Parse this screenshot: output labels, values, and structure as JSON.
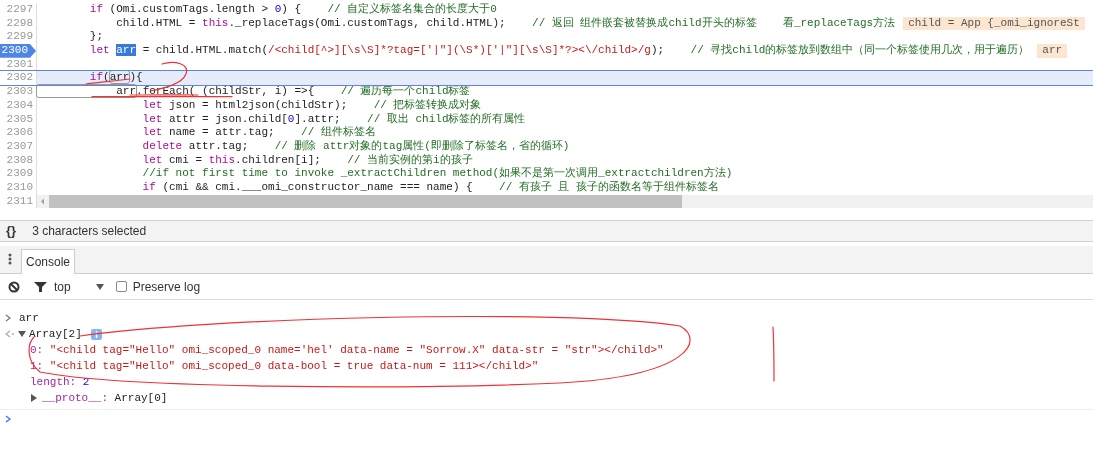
{
  "code_lines": [
    {
      "number": "2297",
      "breakpoint": false,
      "current": false,
      "tokens": [
        {
          "text": "        if",
          "kind": "keyword"
        },
        {
          "text": " (Omi.customTags.length > ",
          "kind": "plain"
        },
        {
          "text": "0",
          "kind": "number"
        },
        {
          "text": ") {    ",
          "kind": "plain"
        },
        {
          "text": "// 自定义标签名集合的长度大于0",
          "kind": "comment"
        }
      ]
    },
    {
      "number": "2298",
      "breakpoint": false,
      "current": false,
      "tokens": [
        {
          "text": "            child.HTML = ",
          "kind": "plain"
        },
        {
          "text": "this",
          "kind": "keyword"
        },
        {
          "text": "._replaceTags(Omi.customTags, child.HTML);    ",
          "kind": "plain"
        },
        {
          "text": "// 返回 组件嵌套被替换成child开头的标签    看_replaceTags方法",
          "kind": "comment"
        }
      ],
      "inline_value": "child = App {_omi_ignoreSt"
    },
    {
      "number": "2299",
      "breakpoint": false,
      "current": false,
      "tokens": [
        {
          "text": "        };",
          "kind": "plain"
        }
      ]
    },
    {
      "number": "2300",
      "breakpoint": true,
      "current": false,
      "tokens": [
        {
          "text": "        let ",
          "kind": "keyword"
        },
        {
          "text": "arr",
          "kind": "selection"
        },
        {
          "text": " = child.HTML.match(",
          "kind": "plain"
        },
        {
          "text": "/<child[^>][\\s\\S]*?tag=['|\"](\\S*)['|\"][\\s\\S]*?><\\/child>/g",
          "kind": "regex"
        },
        {
          "text": ");    ",
          "kind": "plain"
        },
        {
          "text": "// 寻找child的标签放到数组中（同一个标签使用几次，用于遍历）",
          "kind": "comment"
        }
      ],
      "inline_value": "arr"
    },
    {
      "number": "2301",
      "breakpoint": false,
      "current": false
    },
    {
      "number": "2302",
      "breakpoint": false,
      "current": true,
      "tokens": [
        {
          "text": "        if",
          "kind": "keyword"
        },
        {
          "text": "(",
          "kind": "plain"
        },
        {
          "text": "arr",
          "kind": "occurrence"
        },
        {
          "text": "){",
          "kind": "plain"
        }
      ]
    },
    {
      "number": "2303",
      "breakpoint": false,
      "current": false,
      "tokens": [
        {
          "text": "            arr",
          "kind": "occurrence"
        },
        {
          "text": ".forEach( (childStr, i) =>{    ",
          "kind": "plain"
        },
        {
          "text": "// 遍历每一个child标签",
          "kind": "comment"
        }
      ]
    },
    {
      "number": "2304",
      "breakpoint": false,
      "current": false,
      "tokens": [
        {
          "text": "                let",
          "kind": "keyword"
        },
        {
          "text": " json = html2json(childStr);    ",
          "kind": "plain"
        },
        {
          "text": "// 把标签转换成对象",
          "kind": "comment"
        }
      ]
    },
    {
      "number": "2305",
      "breakpoint": false,
      "current": false,
      "tokens": [
        {
          "text": "                let",
          "kind": "keyword"
        },
        {
          "text": " attr = json.child[",
          "kind": "plain"
        },
        {
          "text": "0",
          "kind": "number"
        },
        {
          "text": "].attr;    ",
          "kind": "plain"
        },
        {
          "text": "// 取出 child标签的所有属性",
          "kind": "comment"
        }
      ]
    },
    {
      "number": "2306",
      "breakpoint": false,
      "current": false,
      "tokens": [
        {
          "text": "                let",
          "kind": "keyword"
        },
        {
          "text": " name = attr.tag;    ",
          "kind": "plain"
        },
        {
          "text": "// 组件标签名",
          "kind": "comment"
        }
      ]
    },
    {
      "number": "2307",
      "breakpoint": false,
      "current": false,
      "tokens": [
        {
          "text": "                delete",
          "kind": "keyword"
        },
        {
          "text": " attr.tag;    ",
          "kind": "plain"
        },
        {
          "text": "// 删除 attr对象的tag属性(即删除了标签名，省的循环)",
          "kind": "comment"
        }
      ]
    },
    {
      "number": "2308",
      "breakpoint": false,
      "current": false,
      "tokens": [
        {
          "text": "                let",
          "kind": "keyword"
        },
        {
          "text": " cmi = ",
          "kind": "plain"
        },
        {
          "text": "this",
          "kind": "keyword"
        },
        {
          "text": ".children[i];    ",
          "kind": "plain"
        },
        {
          "text": "// 当前实例的第i的孩子",
          "kind": "comment"
        }
      ]
    },
    {
      "number": "2309",
      "breakpoint": false,
      "current": false,
      "tokens": [
        {
          "text": "                //if not first time to invoke _extractChildren method(如果不是第一次调用_extractchildren方法)",
          "kind": "comment"
        }
      ]
    },
    {
      "number": "2310",
      "breakpoint": false,
      "current": false,
      "tokens": [
        {
          "text": "                if",
          "kind": "keyword"
        },
        {
          "text": " (cmi && cmi.___omi_constructor_name === name) {    ",
          "kind": "plain"
        },
        {
          "text": "// 有孩子 且 孩子的函数名等于组件标签名",
          "kind": "comment"
        }
      ]
    },
    {
      "number": "2311",
      "breakpoint": false,
      "current": false
    }
  ],
  "status_bar": {
    "icon_text": "{}",
    "text": "3 characters selected"
  },
  "drawer_tabs": [
    {
      "label": "Console",
      "selected": true
    }
  ],
  "console_toolbar": {
    "context": "top",
    "preserve_log": {
      "label": "Preserve log",
      "checked": false
    }
  },
  "console_entries": [
    {
      "kind": "input",
      "text": "arr"
    },
    {
      "kind": "result",
      "label": "Array[2]",
      "expanded": true,
      "children": [
        {
          "key": "0:",
          "value": "\"<child tag=\"Hello\" omi_scoped_0 name='hel' data-name = \"Sorrow.X\" data-str = \"str\"></child>\"",
          "kind": "string"
        },
        {
          "key": "1:",
          "value": "\"<child tag=\"Hello\" omi_scoped_0 data-bool = true data-num = 111></child>\"",
          "kind": "string"
        },
        {
          "key": "length:",
          "value": "2",
          "kind": "number"
        },
        {
          "key": "__proto__:",
          "value": "Array[0]",
          "kind": "object",
          "expanded": false
        }
      ]
    }
  ]
}
